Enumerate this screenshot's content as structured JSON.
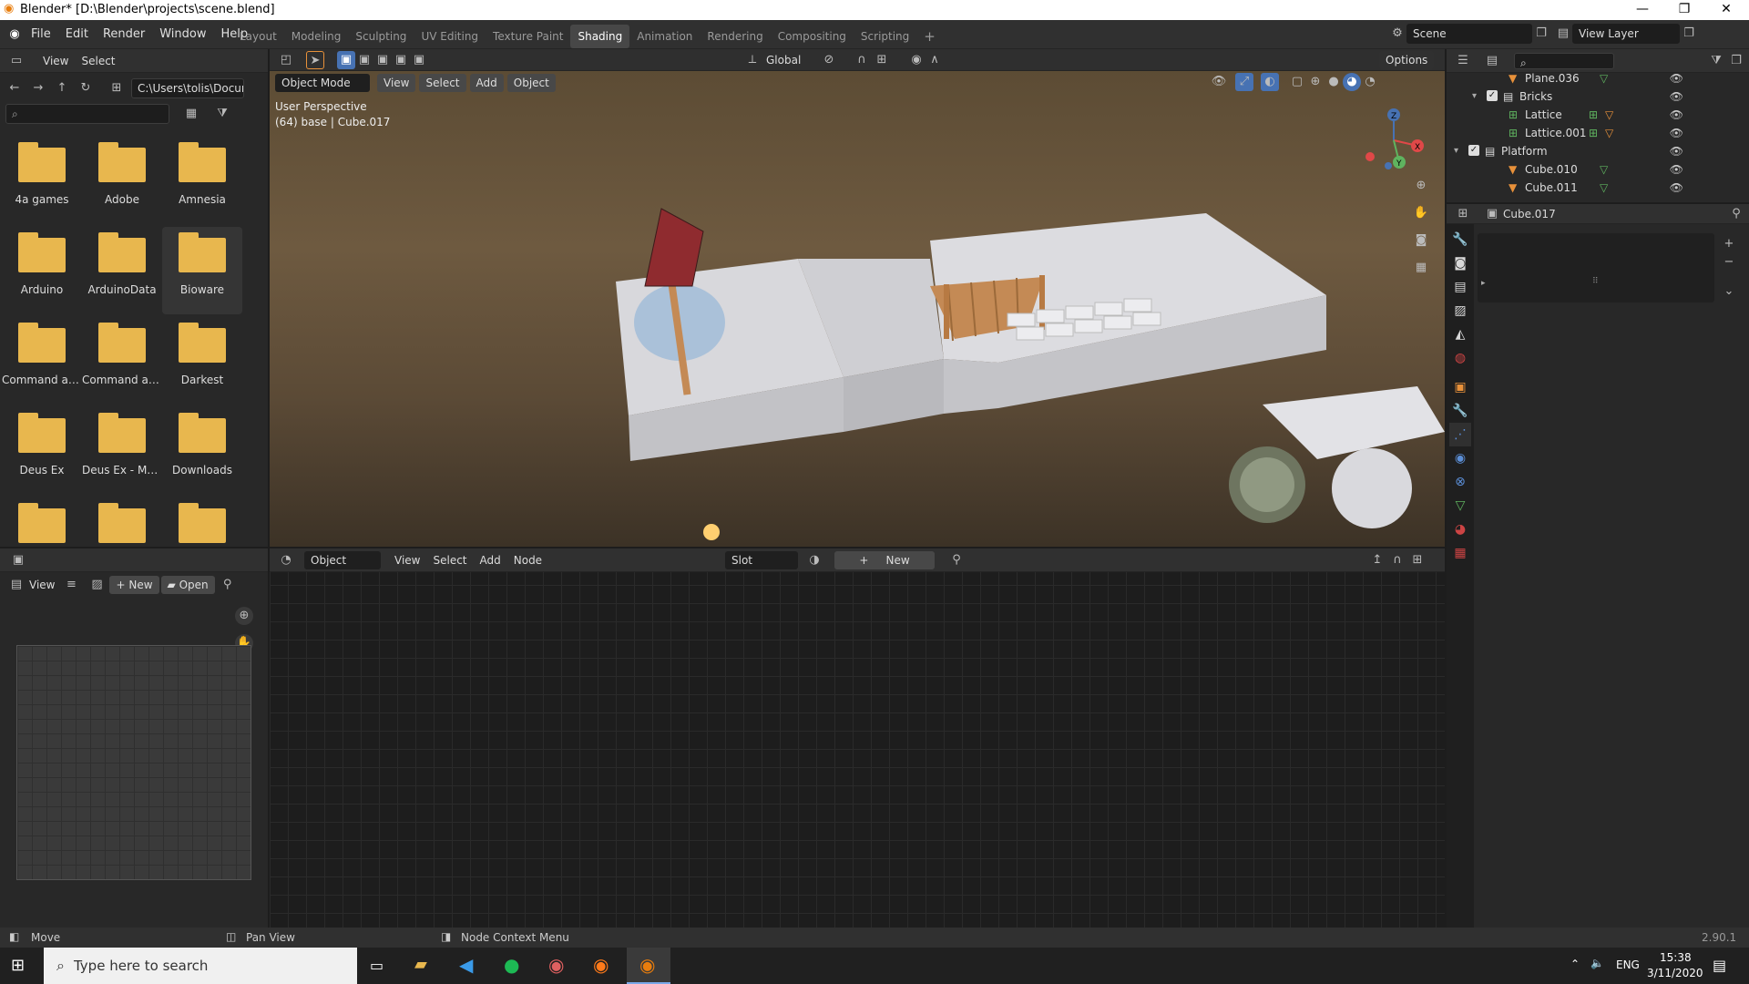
{
  "window": {
    "title": "Blender* [D:\\Blender\\projects\\scene.blend]",
    "min": "—",
    "max": "❐",
    "close": "✕"
  },
  "menubar": {
    "items": [
      "File",
      "Edit",
      "Render",
      "Window",
      "Help"
    ]
  },
  "workspaces": {
    "tabs": [
      "Layout",
      "Modeling",
      "Sculpting",
      "UV Editing",
      "Texture Paint",
      "Shading",
      "Animation",
      "Rendering",
      "Compositing",
      "Scripting"
    ],
    "active": "Shading",
    "add": "+"
  },
  "scene": {
    "label": "Scene",
    "viewlayer": "View Layer"
  },
  "filebrowser": {
    "view": "View",
    "select": "Select",
    "path": "C:\\Users\\tolis\\Docume...",
    "search_placeholder": "",
    "folders": [
      "4a games",
      "Adobe",
      "Amnesia",
      "Arduino",
      "ArduinoData",
      "Bioware",
      "Command an...",
      "Command an...",
      "Darkest",
      "Deus Ex",
      "Deus Ex - Ma...",
      "Downloads",
      "",
      "",
      ""
    ],
    "selected_index": 5
  },
  "viewport": {
    "mode": "Object Mode",
    "menus": [
      "View",
      "Select",
      "Add",
      "Object"
    ],
    "transform": "Global",
    "options": "Options",
    "perspective": "User Perspective",
    "info": "(64) base | Cube.017",
    "gizmo": {
      "z": "Z",
      "x": "X",
      "y": "Y"
    }
  },
  "nodeeditor": {
    "object": "Object",
    "menus": [
      "View",
      "Select",
      "Add",
      "Node"
    ],
    "slot": "Slot",
    "new": "New"
  },
  "imageeditor": {
    "view": "View",
    "new": "New",
    "open": "Open"
  },
  "outliner": {
    "rows": [
      {
        "name": "Plane.036",
        "indent": 3,
        "icon": "tri",
        "extra": "mesh"
      },
      {
        "name": "Bricks",
        "indent": 2,
        "icon": "coll",
        "expand": "▾",
        "check": true
      },
      {
        "name": "Lattice",
        "indent": 3,
        "icon": "lattice",
        "extra": "lattice+tri"
      },
      {
        "name": "Lattice.001",
        "indent": 3,
        "icon": "lattice",
        "extra": "lattice+tri"
      },
      {
        "name": "Platform",
        "indent": 1,
        "icon": "coll",
        "expand": "▾",
        "check": true
      },
      {
        "name": "Cube.010",
        "indent": 3,
        "icon": "tri",
        "extra": "mesh"
      },
      {
        "name": "Cube.011",
        "indent": 3,
        "icon": "tri",
        "extra": "mesh"
      }
    ]
  },
  "properties": {
    "object": "Cube.017"
  },
  "statusbar": {
    "left": "Move",
    "mid": "Pan View",
    "right": "Node Context Menu",
    "version": "2.90.1"
  },
  "taskbar": {
    "search_placeholder": "Type here to search",
    "lang": "ENG",
    "time": "15:38",
    "date": "3/11/2020"
  },
  "colors": {
    "accent": "#4772b3",
    "folder": "#e8b74e",
    "orange": "#e8913a",
    "green": "#5fb35f"
  }
}
